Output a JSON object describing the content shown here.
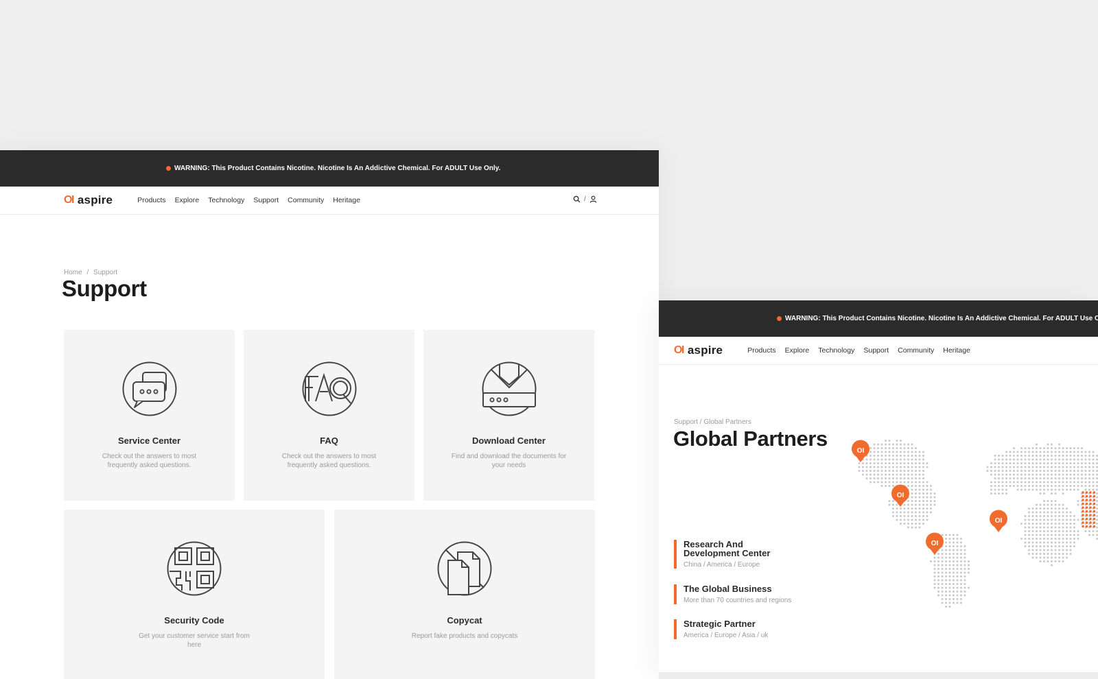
{
  "warning_text": "WARNING: This Product Contains Nicotine. Nicotine Is An Addictive Chemical. For ADULT Use Only.",
  "brand": {
    "mark": "OI",
    "name": "aspire",
    "accent": "#f26b2e",
    "dark": "#2b2b2b"
  },
  "nav": [
    "Products",
    "Explore",
    "Technology",
    "Support",
    "Community",
    "Heritage"
  ],
  "support_page": {
    "breadcrumb": {
      "home": "Home",
      "sep": "/",
      "current": "Support"
    },
    "title": "Support",
    "cards": [
      {
        "title": "Service Center",
        "desc": "Check out the answers to most frequently asked questions.",
        "icon": "chat-bubbles-icon"
      },
      {
        "title": "FAQ",
        "desc": "Check out the answers to most frequently asked questions.",
        "icon": "faq-icon"
      },
      {
        "title": "Download Center",
        "desc": "Find and download the documents for your needs",
        "icon": "download-icon"
      },
      {
        "title": "Security Code",
        "desc": "Get your customer service start from here",
        "icon": "qr-code-icon"
      },
      {
        "title": "Copycat",
        "desc": "Report fake products and copycats",
        "icon": "copycat-documents-icon"
      }
    ]
  },
  "partners_page": {
    "breadcrumb": "Support / Global Partners",
    "title": "Global Partners",
    "items": [
      {
        "title_line1": "Research And",
        "title_line2": "Development Center",
        "sub": "China / America / Europe"
      },
      {
        "title_line1": "The Global Business",
        "sub": "More than 70 countries and regions"
      },
      {
        "title_line1": "Strategic Partner",
        "sub": "America / Europe / Asia / uk"
      }
    ]
  }
}
